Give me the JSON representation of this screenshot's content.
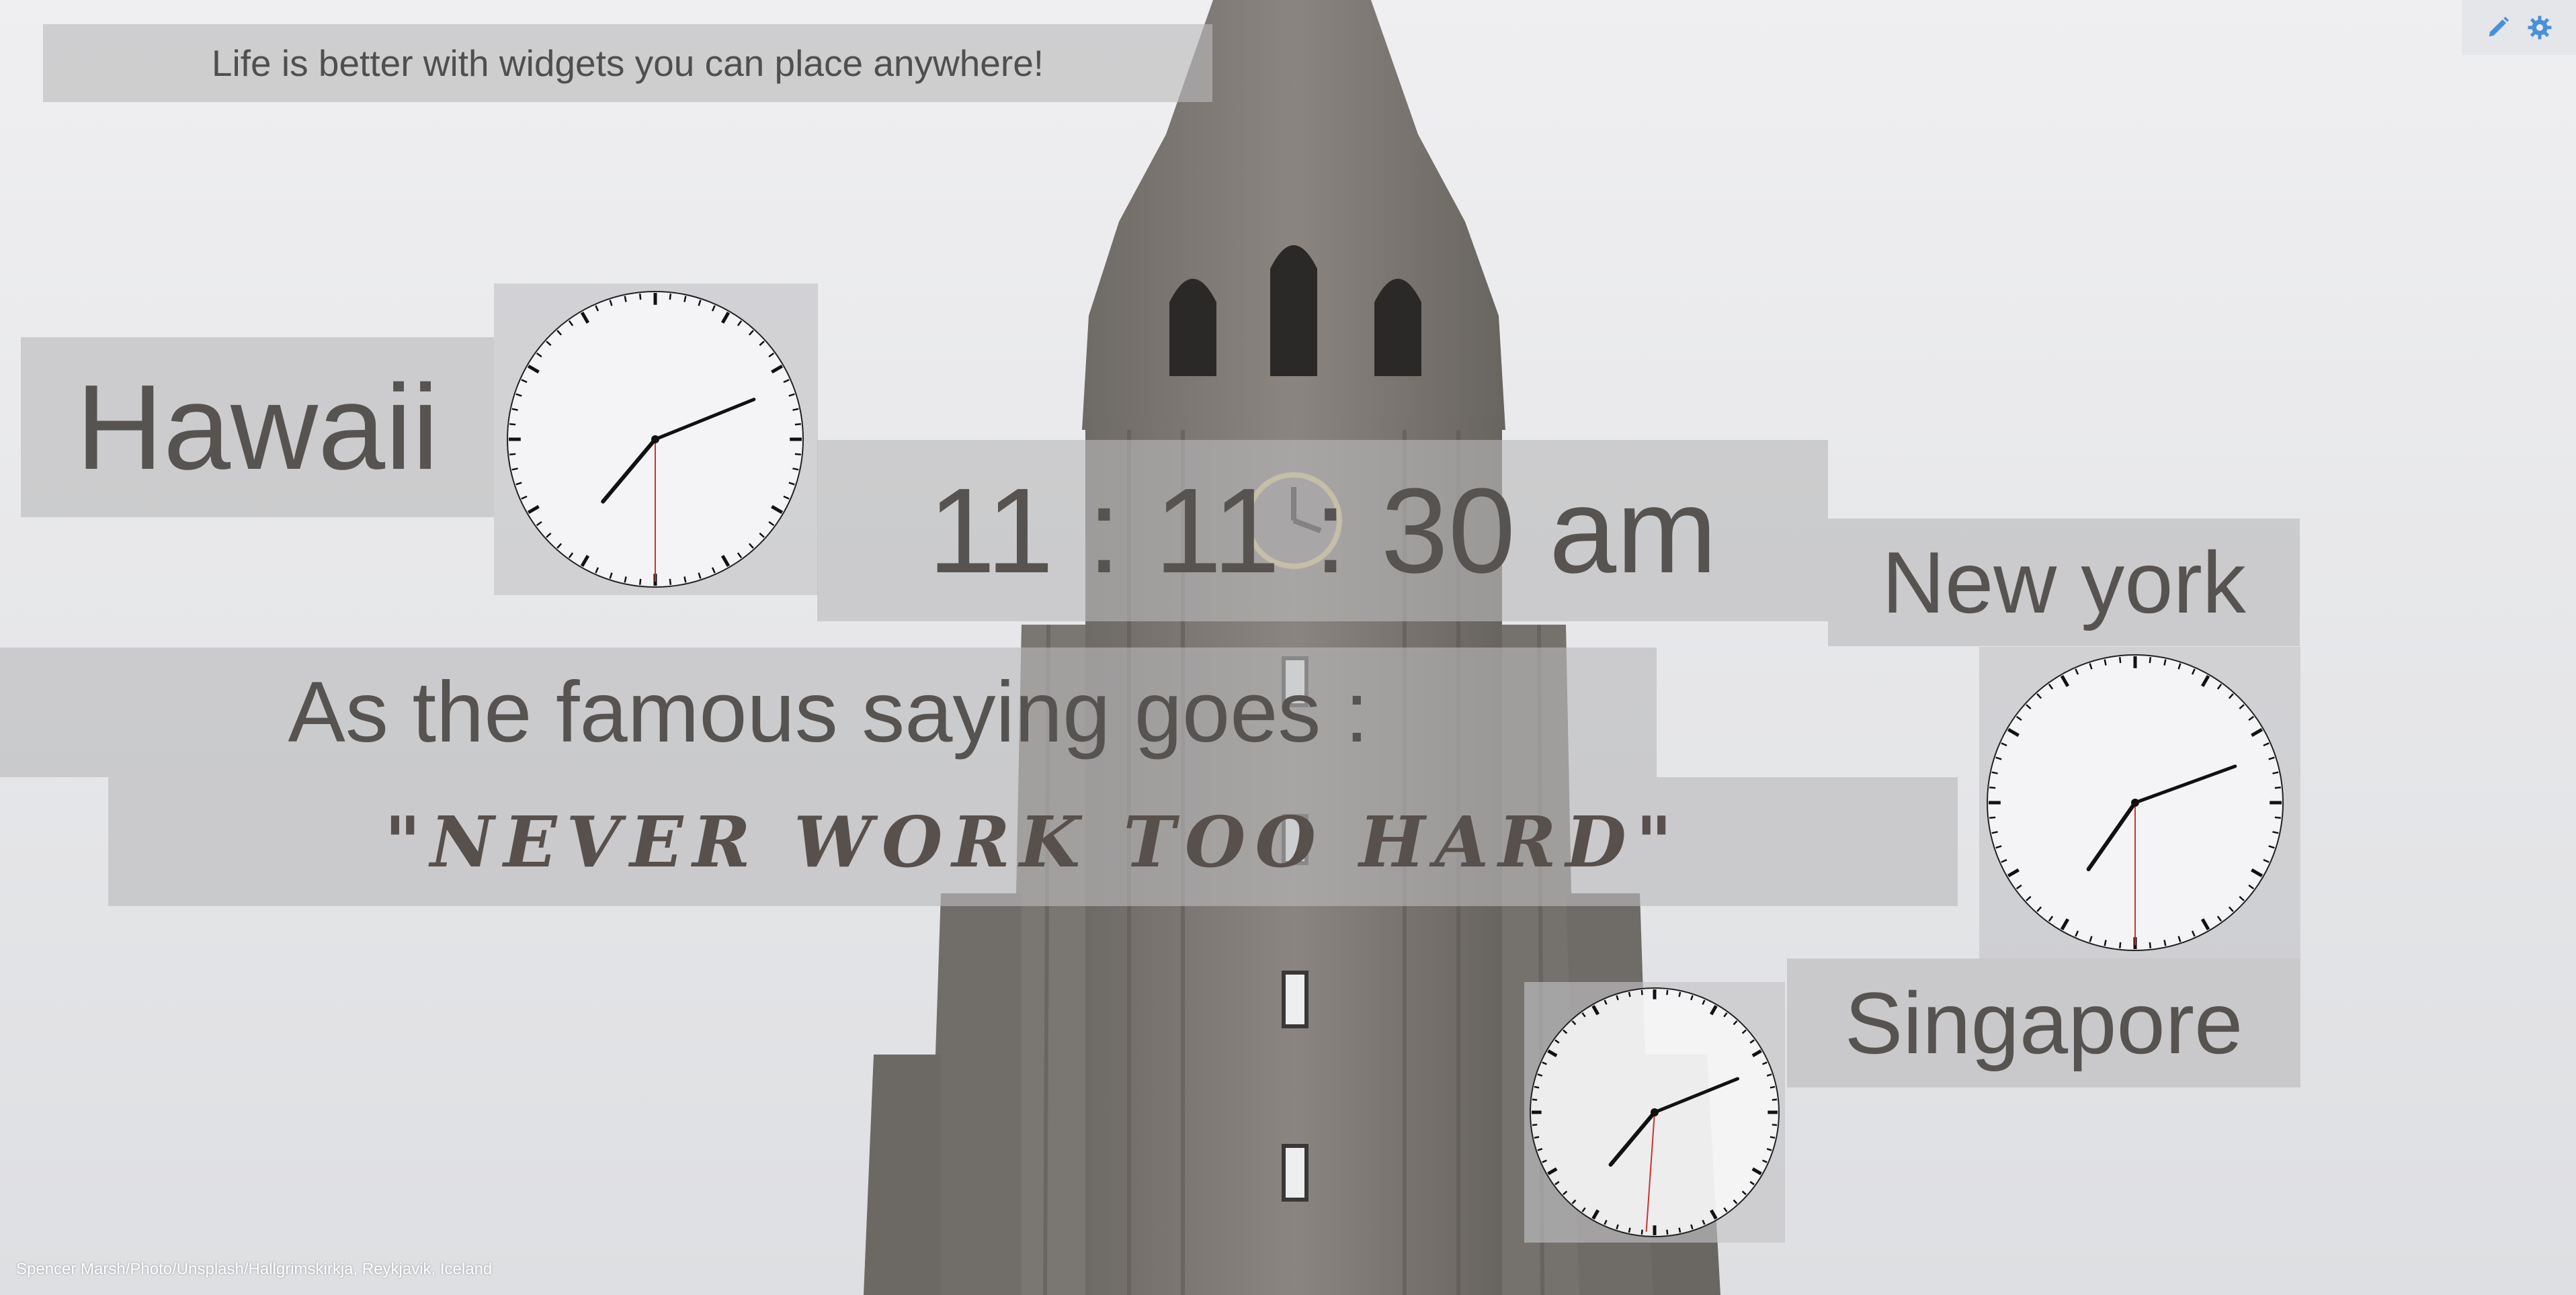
{
  "banner": {
    "text": "Life is better with widgets you can place anywhere!"
  },
  "time": {
    "hours": "11",
    "minutes": "11",
    "seconds": "30",
    "meridiem": "am",
    "separator": ":"
  },
  "cities": {
    "hawaii": {
      "label": "Hawaii"
    },
    "new_york": {
      "label": "New york"
    },
    "singapore": {
      "label": "Singapore"
    }
  },
  "saying": {
    "text": "As the famous saying goes :"
  },
  "quote": {
    "text": "\"NEVER WORK TOO HARD\""
  },
  "toolbar": {
    "edit_icon": "pencil-icon",
    "settings_icon": "gear-icon",
    "accent": "#4a90d9"
  },
  "credit": {
    "text": "Spencer Marsh/Photo/Unsplash/Hallgrimskirkja, Reykjavik, Iceland"
  },
  "colors": {
    "widget_text": "#565350",
    "second_hand": "#d0312d",
    "hand": "#111111"
  }
}
